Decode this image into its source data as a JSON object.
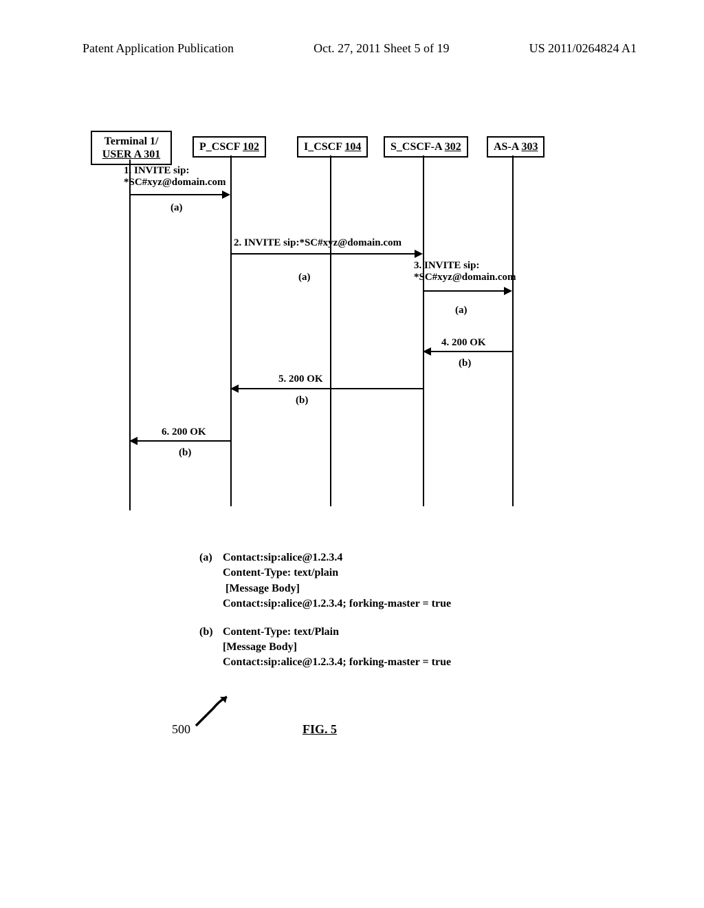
{
  "header": {
    "left": "Patent Application Publication",
    "center": "Oct. 27, 2011   Sheet 5 of 19",
    "right": "US 2011/0264824 A1"
  },
  "actors": {
    "terminal": {
      "line1": "Terminal 1/",
      "line2": "USER A",
      "ref": "  301"
    },
    "pcscf": {
      "label": "P_CSCF ",
      "ref": "102"
    },
    "icscf": {
      "label": "I_CSCF ",
      "ref": "104"
    },
    "scscf": {
      "label": "S_CSCF-A ",
      "ref": "302"
    },
    "asa": {
      "label": "AS-A ",
      "ref": "303"
    }
  },
  "messages": {
    "m1": "1. INVITE sip:\n*SC#xyz@domain.com",
    "m1sub": "(a)",
    "m2": "2. INVITE sip:*SC#xyz@domain.com",
    "m2sub": "(a)",
    "m3": "3. INVITE sip:\n*SC#xyz@domain.com",
    "m3sub": "(a)",
    "m4": "4. 200 OK",
    "m4sub": "(b)",
    "m5": "5. 200 OK",
    "m5sub": "(b)",
    "m6": "6. 200 OK",
    "m6sub": "(b)"
  },
  "legend": {
    "a_key": "(a)",
    "a_body": "Contact:sip:alice@1.2.3.4\nContent-Type: text/plain\n [Message Body]\nContact:sip:alice@1.2.3.4; forking-master = true",
    "b_key": "(b)",
    "b_body": "Content-Type: text/Plain\n[Message Body]\nContact:sip:alice@1.2.3.4; forking-master = true"
  },
  "figure": {
    "num": "500",
    "label": "FIG. 5"
  }
}
